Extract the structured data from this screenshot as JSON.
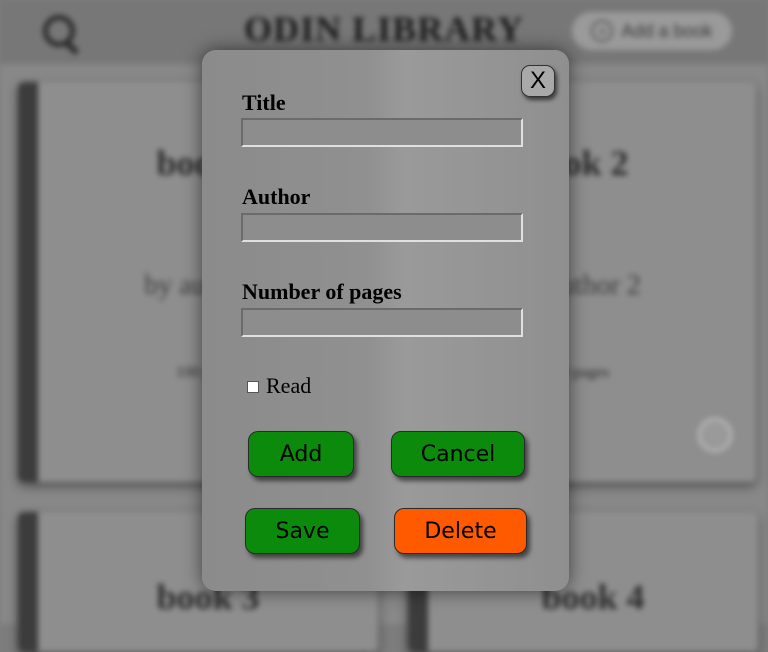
{
  "background": {
    "header": {
      "title": "ODIN LIBRARY",
      "add_book_label": "Add a book"
    },
    "cards": [
      {
        "title": "book 1",
        "author": "by author 1",
        "pages": "100 pages"
      },
      {
        "title": "book 2",
        "author": "by author 2",
        "pages": "100 pages"
      },
      {
        "title": "book 3"
      },
      {
        "title": "book 4"
      }
    ]
  },
  "modal": {
    "close_label": "X",
    "fields": {
      "title_label": "Title",
      "title_value": "",
      "author_label": "Author",
      "author_value": "",
      "pages_label": "Number of pages",
      "pages_value": ""
    },
    "read": {
      "label": "Read",
      "checked": false
    },
    "buttons": {
      "add": "Add",
      "cancel": "Cancel",
      "save": "Save",
      "delete": "Delete"
    }
  },
  "colors": {
    "green_button": "#0b8a0b",
    "delete_button": "#ff5a00"
  }
}
